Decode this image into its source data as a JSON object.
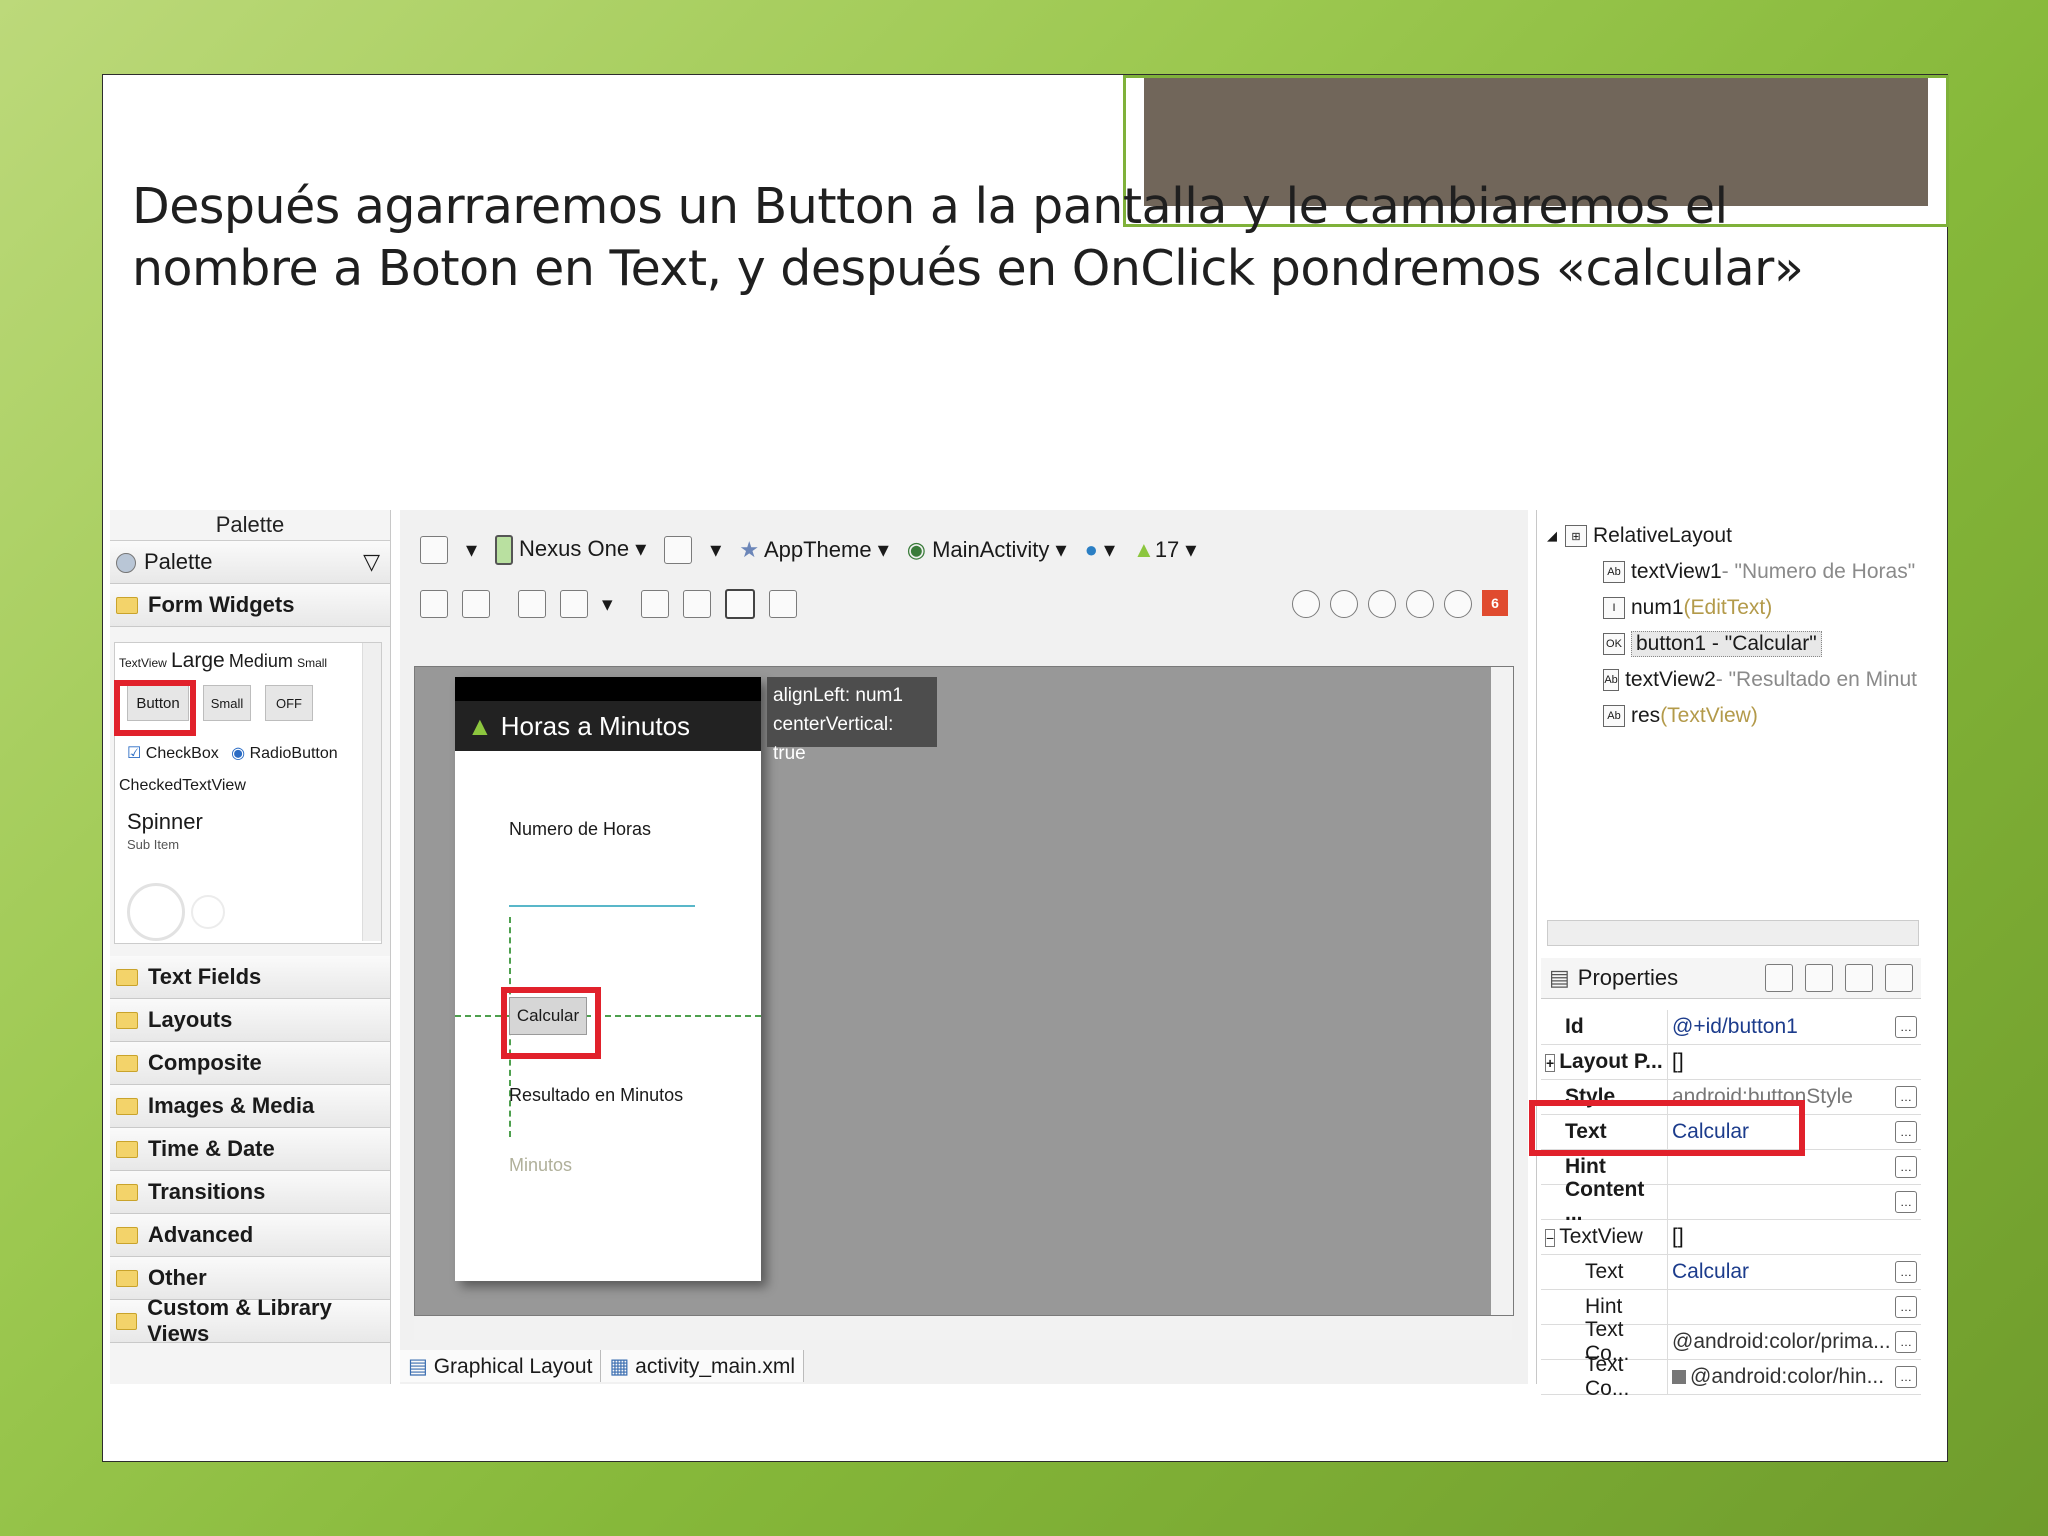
{
  "caption": {
    "line1": "Después agarraremos un Button a la pantalla y le cambiaremos el",
    "line2": "nombre a Boton en Text, y después en OnClick pondremos «calcular»"
  },
  "palette": {
    "header": "Palette",
    "dropdown": "Palette",
    "open_category": "Form Widgets",
    "text_sizes": [
      "TextView",
      "Large",
      "Medium",
      "Small"
    ],
    "buttons": [
      "Button",
      "Small",
      "OFF"
    ],
    "checkbox": "CheckBox",
    "radio": "RadioButton",
    "checked_text": "CheckedTextView",
    "spinner": "Spinner",
    "spinner_sub": "Sub Item",
    "categories": [
      "Text Fields",
      "Layouts",
      "Composite",
      "Images & Media",
      "Time & Date",
      "Transitions",
      "Advanced",
      "Other",
      "Custom & Library Views"
    ]
  },
  "toolbar": {
    "device": "Nexus One",
    "theme": "AppTheme",
    "activity": "MainActivity",
    "api": "17",
    "error_count": "6"
  },
  "canvas": {
    "app_title": "Horas a Minutos",
    "tooltip_line1": "alignLeft: num1",
    "tooltip_line2": "centerVertical: true",
    "label_horas": "Numero de Horas",
    "button_text": "Calcular",
    "label_resultado": "Resultado en Minutos",
    "label_minutos": "Minutos"
  },
  "bottom_tabs": [
    "Graphical Layout",
    "activity_main.xml"
  ],
  "outline": {
    "root": "RelativeLayout",
    "items": [
      {
        "id": "textView1",
        "desc": " - \"Numero de Horas\"",
        "icon": "Ab"
      },
      {
        "id": "num1",
        "desc": " (EditText)",
        "icon": "I"
      },
      {
        "id": "button1",
        "desc": " - \"Calcular\"",
        "icon": "OK"
      },
      {
        "id": "textView2",
        "desc": " - \"Resultado en Minut",
        "icon": "Ab"
      },
      {
        "id": "res",
        "desc": " (TextView)",
        "icon": "Ab"
      }
    ]
  },
  "properties": {
    "header": "Properties",
    "rows": [
      {
        "key": "Id",
        "value": "@+id/button1",
        "bold": true
      },
      {
        "key": "Layout P...",
        "value": "[]",
        "bold": true
      },
      {
        "key": "Style",
        "value": "android:buttonStyle",
        "bold": true
      },
      {
        "key": "Text",
        "value": "Calcular",
        "bold": true
      },
      {
        "key": "Hint",
        "value": "",
        "bold": true
      },
      {
        "key": "Content ...",
        "value": "",
        "bold": true
      },
      {
        "key": "TextView",
        "value": "[]",
        "bold": false
      },
      {
        "key": "Text",
        "value": "Calcular",
        "bold": false
      },
      {
        "key": "Hint",
        "value": "",
        "bold": false
      },
      {
        "key": "Text Co...",
        "value": "@android:color/prima...",
        "bold": false
      },
      {
        "key": "Text Co...",
        "value": "@android:color/hin...",
        "bold": false
      }
    ]
  },
  "colors": {
    "highlight": "#e1212b",
    "accent": "#7fb13a",
    "title_box": "#71665a"
  }
}
